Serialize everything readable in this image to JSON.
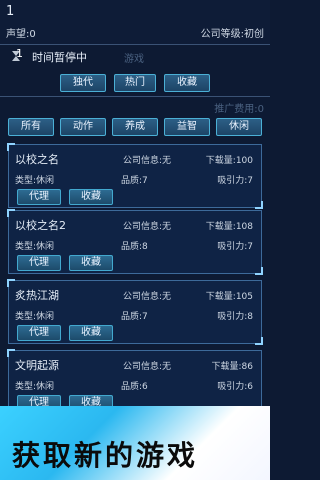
{
  "header": {
    "day": "1",
    "reputation": "声望:0",
    "company_level": "公司等级:初创"
  },
  "time": {
    "number": "1",
    "status": "时间暂停中",
    "section_label": "游戏"
  },
  "tabs": [
    "独代",
    "热门",
    "收藏"
  ],
  "fee_label": "推广费用:0",
  "categories": [
    "所有",
    "动作",
    "养成",
    "益智",
    "休闲"
  ],
  "games": [
    {
      "name": "以校之名",
      "info": "公司信息:无",
      "downloads": "下载量:100",
      "type": "类型:休闲",
      "quality": "品质:7",
      "appeal": "吸引力:7",
      "agent": "代理",
      "favorite": "收藏"
    },
    {
      "name": "以校之名2",
      "info": "公司信息:无",
      "downloads": "下载量:108",
      "type": "类型:休闲",
      "quality": "品质:8",
      "appeal": "吸引力:7",
      "agent": "代理",
      "favorite": "收藏"
    },
    {
      "name": "炙热江湖",
      "info": "公司信息:无",
      "downloads": "下载量:105",
      "type": "类型:休闲",
      "quality": "品质:7",
      "appeal": "吸引力:8",
      "agent": "代理",
      "favorite": "收藏"
    },
    {
      "name": "文明起源",
      "info": "公司信息:无",
      "downloads": "下载量:86",
      "type": "类型:休闲",
      "quality": "品质:6",
      "appeal": "吸引力:6",
      "agent": "代理",
      "favorite": "收藏"
    }
  ],
  "banner": {
    "text": "获取新的游戏"
  },
  "colors": {
    "background": "#0d1a33",
    "button": "#2c5f86",
    "button_border": "#4bb0d6",
    "banner_blue": "#3bd1ff"
  },
  "icons": {
    "time": "hourglass-icon"
  }
}
